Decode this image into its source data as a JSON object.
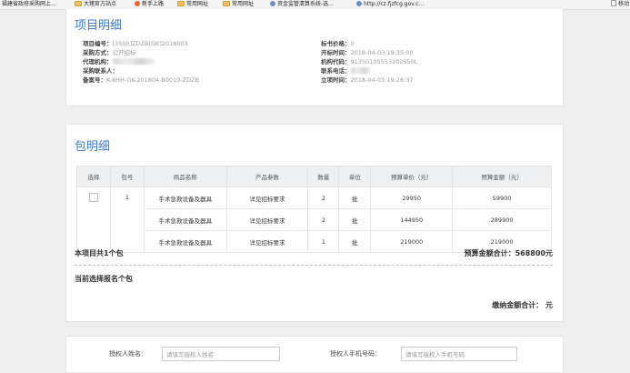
{
  "bookmarks": [
    {
      "label": "福建省政府采购网上...",
      "icon": "page-icon"
    },
    {
      "label": "大猪官方站点",
      "icon": "folder-icon"
    },
    {
      "label": "新手上路",
      "icon": "fire-icon"
    },
    {
      "label": "常用网址",
      "icon": "folder-icon"
    },
    {
      "label": "常用网址",
      "icon": "folder-icon"
    },
    {
      "label": "资金监管清算系统-选...",
      "icon": "globe-icon"
    },
    {
      "label": "http://cz.fjzfcg.gov.c...",
      "icon": "globe-icon"
    },
    {
      "label": "移动",
      "icon": "page-icon"
    }
  ],
  "project": {
    "title": "项目明细",
    "fields_left": [
      {
        "label": "项目编号：",
        "value": "[3500]ZDZB[GK]2018003"
      },
      {
        "label": "采购方式：",
        "value": "公开招标"
      },
      {
        "label": "代理机构：",
        "value": ""
      },
      {
        "label": "采购联系人：",
        "value": ""
      },
      {
        "label": "备案号：",
        "value": "K-XHH-GK-201804-B0010-ZDZB"
      }
    ],
    "fields_right": [
      {
        "label": "标书价格：",
        "value": "0"
      },
      {
        "label": "开标时间：",
        "value": "2018-04-03 19:35:00"
      },
      {
        "label": "机构代码：",
        "value": "91350105553202550L"
      },
      {
        "label": "联系电话：",
        "value": ""
      },
      {
        "label": "立项时间：",
        "value": "2018-04-03 19:26:37"
      }
    ]
  },
  "package": {
    "title": "包明细",
    "columns": [
      "选择",
      "包号",
      "商品名称",
      "产品参数",
      "数量",
      "单位",
      "预算单价（元）",
      "预算金额（元）"
    ],
    "group_no": "1",
    "rows": [
      {
        "name": "手术急救设备及器具",
        "param": "详见招标要求",
        "qty": "2",
        "unit": "批",
        "unit_price": "29950",
        "amount": "59900"
      },
      {
        "name": "手术急救设备及器具",
        "param": "详见招标要求",
        "qty": "2",
        "unit": "批",
        "unit_price": "144950",
        "amount": "289900"
      },
      {
        "name": "手术急救设备及器具",
        "param": "详见招标要求",
        "qty": "1",
        "unit": "批",
        "unit_price": "219000",
        "amount": "219000"
      }
    ],
    "total_packages": "本项目共1个包",
    "budget_total": "预算金额合计：568800元",
    "selected_text": "当前选择报名个包",
    "fee_total": "缴纳金额合计： 元"
  },
  "auth": {
    "name_label": "授权人姓名：",
    "name_placeholder": "请填写授权人姓名",
    "phone_label": "授权人手机号码：",
    "phone_placeholder": "请填写授权人手机号码"
  }
}
